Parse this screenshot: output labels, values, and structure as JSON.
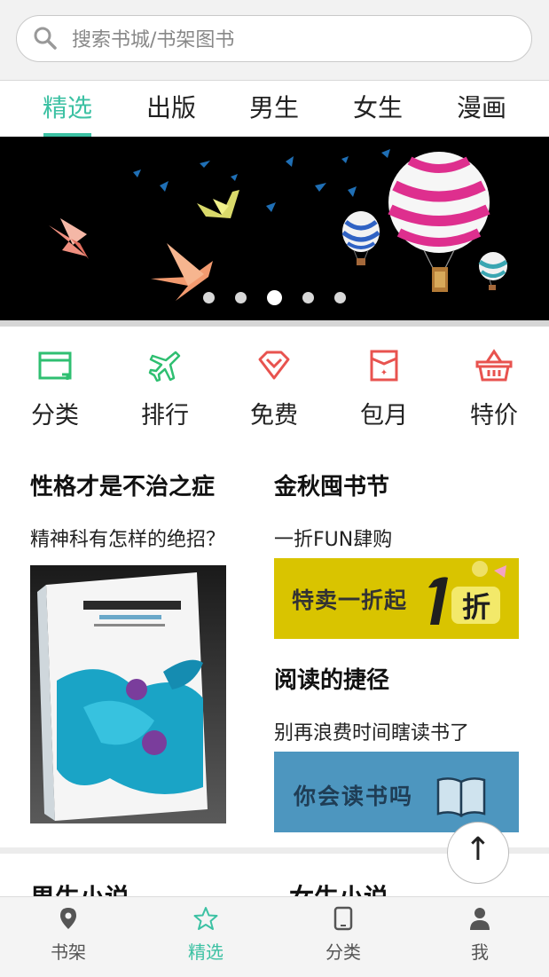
{
  "search": {
    "placeholder": "搜索书城/书架图书"
  },
  "tabs": [
    {
      "label": "精选",
      "active": true
    },
    {
      "label": "出版"
    },
    {
      "label": "男生"
    },
    {
      "label": "女生"
    },
    {
      "label": "漫画"
    }
  ],
  "banner": {
    "slide_count": 5,
    "active_index": 2
  },
  "categories": [
    {
      "label": "分类",
      "icon": "folder-icon",
      "color": "#2fbf71"
    },
    {
      "label": "排行",
      "icon": "airplane-icon",
      "color": "#2fbf71"
    },
    {
      "label": "免费",
      "icon": "diamond-icon",
      "color": "#e8534f"
    },
    {
      "label": "包月",
      "icon": "calendar-icon",
      "color": "#e8534f"
    },
    {
      "label": "特价",
      "icon": "basket-icon",
      "color": "#e8534f"
    }
  ],
  "features": {
    "left": {
      "title": "性格才是不治之症",
      "subtitle": "精神科有怎样的绝招？"
    },
    "right_top": {
      "title": "金秋囤书节",
      "subtitle": "一折FUN肆购",
      "banner_text": "特卖一折起"
    },
    "right_bottom": {
      "title": "阅读的捷径",
      "subtitle": "别再浪费时间瞎读书了",
      "banner_text": "你会读书吗"
    }
  },
  "sections": {
    "male_novels": "男生小说",
    "female_novels": "女生小说"
  },
  "back_to_top": "↑",
  "bottom_nav": [
    {
      "label": "书架",
      "icon": "location-pin-icon"
    },
    {
      "label": "精选",
      "icon": "star-icon",
      "active": true
    },
    {
      "label": "分类",
      "icon": "tablet-icon"
    },
    {
      "label": "我",
      "icon": "user-icon"
    }
  ],
  "colors": {
    "accent": "#3cc1a3",
    "green_icon": "#2fbf71",
    "red_icon": "#e8534f"
  }
}
